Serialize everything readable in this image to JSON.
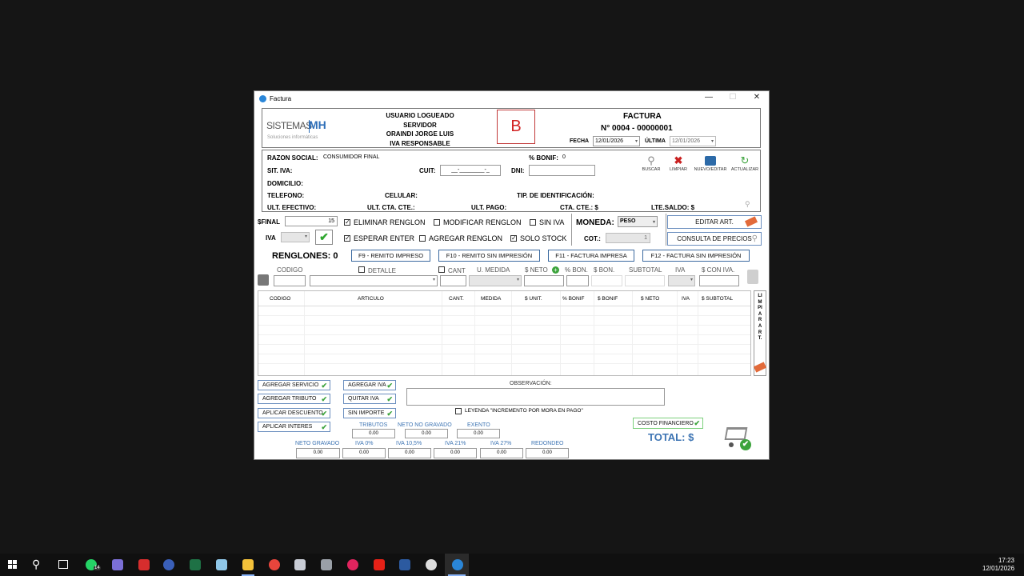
{
  "window": {
    "title": "Factura",
    "minimize": "—",
    "maximize": "☐",
    "close": "✕"
  },
  "header": {
    "logo_main": "SISTEMAS",
    "logo_mark": "MH",
    "logo_sub": "Soluciones informáticas",
    "user_lines": [
      "USUARIO LOGUEADO",
      "SERVIDOR",
      "ORAINDI JORGE LUIS",
      "IVA RESPONSABLE INSCRIPTO"
    ],
    "invoice_letter": "B",
    "doc_title": "FACTURA",
    "doc_number": "N°  0004  -  00000001",
    "fecha_label": "FECHA",
    "fecha_value": "12/01/2026",
    "ultima_label": "ÚLTIMA",
    "ultima_value": "12/01/2026"
  },
  "client": {
    "razon_social_label": "RAZON SOCIAL:",
    "razon_social_value": "CONSUMIDOR FINAL",
    "bonif_label": "% BONIF:",
    "bonif_value": "0",
    "sit_iva_label": "SIT. IVA:",
    "cuit_label": "CUIT:",
    "cuit_value": "__-________-_",
    "dni_label": "DNI:",
    "domicilio_label": "DOMICILIO:",
    "telefono_label": "TELEFONO:",
    "celular_label": "CELULAR:",
    "tip_ident_label": "TIP. DE IDENTIFICACIÓN:",
    "ult_efectivo_label": "ULT. EFECTIVO:",
    "ult_cta_cte_label": "ULT. CTA. CTE.:",
    "ult_pago_label": "ULT. PAGO:",
    "cta_cte_label": "CTA. CTE.: $",
    "lte_saldo_label": "LTE.SALDO: $",
    "actions": {
      "buscar": "BUSCAR",
      "limpiar": "LIMPIAR",
      "nuevo": "NUEVO/EDITAR",
      "actualizar": "ACTUALIZAR"
    }
  },
  "options": {
    "final_label": "$FINAL",
    "final_value": "15",
    "iva_label": "IVA",
    "eliminar_renglon": "ELIMINAR RENGLON",
    "modificar_renglon": "MODIFICAR RENGLON",
    "sin_iva": "SIN IVA",
    "esperar_enter": "ESPERAR ENTER",
    "agregar_renglon": "AGREGAR RENGLON",
    "solo_stock": "SOLO STOCK",
    "moneda_label": "MONEDA:",
    "moneda_value": "PESO",
    "cot_label": "COT.:",
    "cot_value": "1",
    "editar_art": "EDITAR ART.",
    "consulta_precios": "CONSULTA DE PRECIOS"
  },
  "fkeys": {
    "renglones": "RENGLONES: 0",
    "f9": "F9 - REMITO IMPRESO",
    "f10": "F10 - REMITO SIN IMPRESIÓN",
    "f11": "F11 - FACTURA IMPRESA",
    "f12": "F12 - FACTURA SIN IMPRESIÓN"
  },
  "entry": {
    "codigo": "CODIGO",
    "detalle": "DETALLE",
    "cant": "CANT",
    "u_medida": "U. MEDIDA",
    "neto": "$ NETO",
    "bon_pct": "% BON.",
    "bon": "$ BON.",
    "subtotal": "SUBTOTAL",
    "iva": "IVA",
    "con_iva": "$ CON IVA."
  },
  "grid": {
    "columns": [
      "CODIGO",
      "ARTICULO",
      "CANT.",
      "MEDIDA",
      "$ UNIT.",
      "% BONIF",
      "$ BONIF",
      "$ NETO",
      "IVA",
      "$ SUBTOTAL"
    ],
    "side_label": "LIMPIAR ART."
  },
  "footer": {
    "agregar_servicio": "AGREGAR SERVICIO",
    "agregar_tributo": "AGREGAR TRIBUTO",
    "aplicar_descuento": "APLICAR DESCUENTO",
    "aplicar_interes": "APLICAR INTERES",
    "agregar_iva": "AGREGAR IVA",
    "quitar_iva": "QUITAR IVA",
    "sin_importe": "SIN IMPORTE",
    "observacion_label": "OBSERVACIÓN:",
    "leyenda": "LEYENDA \"INCREMENTO POR MORA EN PAGO\"",
    "costo_financiero": "COSTO FINANCIERO",
    "total_label": "TOTAL: $",
    "tributos_label": "TRIBUTOS",
    "tributos_value": "0.00",
    "neto_no_gravado_label": "NETO NO GRAVADO",
    "neto_no_gravado_value": "0.00",
    "exento_label": "EXENTO",
    "exento_value": "0.00",
    "neto_gravado_label": "NETO GRAVADO",
    "neto_gravado_value": "0.00",
    "iva0_label": "IVA 0%",
    "iva0_value": "0.00",
    "iva105_label": "IVA 10,5%",
    "iva105_value": "0.00",
    "iva21_label": "IVA 21%",
    "iva21_value": "0.00",
    "iva27_label": "IVA 27%",
    "iva27_value": "0.00",
    "redondeo_label": "REDONDEO",
    "redondeo_value": "0.00"
  },
  "taskbar": {
    "whatsapp_badge": "14",
    "time": "17:23",
    "date": "12/01/2026"
  },
  "colors": {
    "accent_blue": "#3d74b3",
    "ok_green": "#3ca33c",
    "letter_red": "#d22222",
    "desktop": "#151515"
  }
}
